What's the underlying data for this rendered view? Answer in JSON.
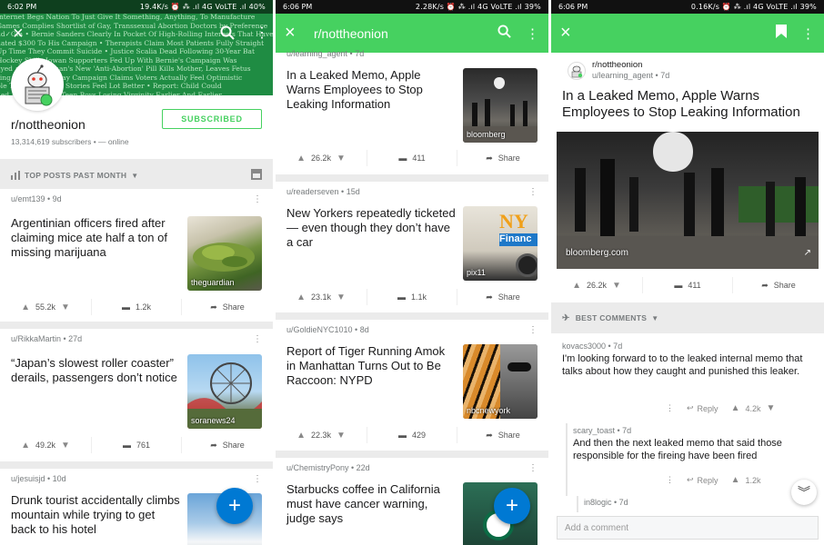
{
  "panel1": {
    "status": {
      "time": "6:02 PM",
      "right": "19.4K/s ⏰ ⁂ .ıl 4G VoLTE .ıl 40%"
    },
    "banner_lines": [
      "Internet Begs Nation To Just Give It Something, Anything, To Manufacture",
      "Games Complies Shortlist of Gay, Transsexual Abortion Doctors by Preference",
      "nd✓Gfa • Bernie Sanders Clearly In Pocket Of High-Rolling Interests That Have",
      "nated $300 To His Campaign • Therapists Claim Most Patients Fully Straight",
      "Up Time They Commit Suicide • Justice Scalia Dead Following 30-Year Bat",
      "Hockey Skills Iowan Supporters Fed Up With Bernie's Campaign Was",
      "ayed • Clear Woman's New 'Anti-Abortion' Pill Kills Mother, Leaves Fetus",
      "sing • Bernie Sunday Campaign Claims Voters Actually Feel Optimistic",
      "ple Tired Of Telling Stories Feel Lot Better • Report: Child Could",
      "ned In Sundown • Teen Boys Losing Virginity Earlier And Earlier",
      "• Gay Teen Worried He Might Be Christian • X Minus One Ice"
    ],
    "header": {
      "close_icon": "×",
      "search_icon": "search",
      "more_icon": "⋮"
    },
    "sub": {
      "name": "r/nottheonion",
      "count": "13,314,619 subscribers • — online",
      "button": "SUBSCRIBED"
    },
    "sort_label": "TOP POSTS PAST MONTH",
    "posts": [
      {
        "meta": "u/emt139 • 9d",
        "title": "Argentinian officers fired after claiming mice ate half a ton of missing marijuana",
        "source": "theguardian",
        "votes": "55.2k",
        "comments": "1.2k",
        "share": "Share"
      },
      {
        "meta": "u/RikkaMartin • 27d",
        "title": "“Japan’s slowest roller coaster” derails, passengers don’t notice",
        "source": "soranews24",
        "votes": "49.2k",
        "comments": "761",
        "share": "Share"
      },
      {
        "meta": "u/jesuisjd • 10d",
        "title": "Drunk tourist accidentally climbs mountain while trying to get back to his hotel",
        "source": "",
        "votes": "",
        "comments": "",
        "share": ""
      }
    ]
  },
  "panel2": {
    "status": {
      "time": "6:06 PM",
      "right": "2.28K/s ⏰ ⁂ .ıl 4G VoLTE .ıl 39%"
    },
    "header": {
      "title": "r/nottheonion"
    },
    "top_meta": "u/learning_agent • 7d",
    "posts": [
      {
        "meta": "",
        "title": "In a Leaked Memo, Apple Warns Employees to Stop Leaking Information",
        "source": "bloomberg",
        "votes": "26.2k",
        "comments": "411",
        "share": "Share"
      },
      {
        "meta": "u/readerseven • 15d",
        "title": "New Yorkers repeatedly ticketed — even though they don’t have a car",
        "source": "pix11",
        "votes": "23.1k",
        "comments": "1.1k",
        "share": "Share"
      },
      {
        "meta": "u/GoldieNYC1010 • 8d",
        "title": "Report of Tiger Running Amok in Manhattan Turns Out to Be Raccoon: NYPD",
        "source": "nbcnewyork",
        "votes": "22.3k",
        "comments": "429",
        "share": "Share"
      },
      {
        "meta": "u/ChemistryPony • 22d",
        "title": "Starbucks coffee in California must have cancer warning, judge says",
        "source": "",
        "votes": "",
        "comments": "",
        "share": ""
      }
    ],
    "thumb_text": {
      "apple": "",
      "ny": "NY",
      "finance": "Financ"
    }
  },
  "panel3": {
    "status": {
      "time": "6:06 PM",
      "right": "0.16K/s ⏰ ⁂ .ıl 4G VoLTE .ıl 39%"
    },
    "post": {
      "sub": "r/nottheonion",
      "author": "u/learning_agent • 7d",
      "title": "In a Leaked Memo, Apple Warns Employees to Stop Leaking Information",
      "domain": "bloomberg.com",
      "votes": "26.2k",
      "comments": "411",
      "share": "Share"
    },
    "best_label": "BEST COMMENTS",
    "comments": [
      {
        "meta": "kovacs3000 • 7d",
        "body": "I'm looking forward to to the leaked internal memo that talks about how they caught and punished this leaker.",
        "reply": "Reply",
        "votes": "4.2k"
      },
      {
        "meta": "scary_toast • 7d",
        "body": "And then the next leaked memo that said those responsible for the fireing have been fired",
        "reply": "Reply",
        "votes": "1.2k"
      },
      {
        "meta": "in8logic • 7d",
        "body": "",
        "reply": "",
        "votes": ""
      }
    ],
    "add_comment": "Add a comment"
  },
  "colors": {
    "green": "#46d160",
    "blue": "#0079d3",
    "banner": "#1f8c43"
  }
}
